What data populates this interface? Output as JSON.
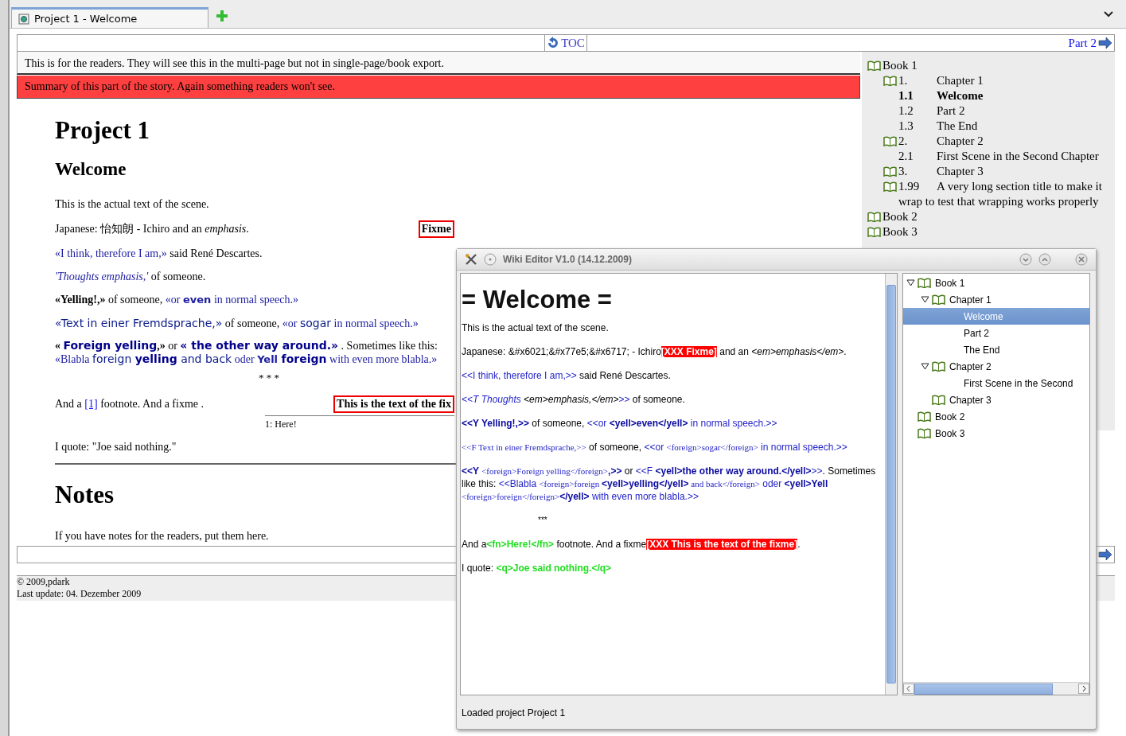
{
  "browser_tabs": [
    {
      "label": "Project 1 - Welcome",
      "selected": true
    }
  ],
  "nav_top": {
    "toc": "TOC",
    "next": "Part 2"
  },
  "reader_note": "This is for the readers. They will see this in the multi-page but not in single-page/book export.",
  "summary": "Summary of this part of the story. Again something readers won't see.",
  "article": {
    "title": "Project 1",
    "heading": "Welcome",
    "blocks": [
      {
        "kind": "para",
        "segments": [
          {
            "kind": "plain",
            "text": "This is the actual text of the scene."
          }
        ]
      },
      {
        "kind": "para",
        "segments": [
          {
            "kind": "plain",
            "text": "Japanese: 怡知朗 - Ichiro and an "
          },
          {
            "kind": "em",
            "text": "emphasis"
          },
          {
            "kind": "plain",
            "text": "."
          }
        ],
        "fixme": "Fixme"
      },
      {
        "kind": "para",
        "segments": [
          {
            "kind": "quote",
            "text": "«I think, therefore I am,»"
          },
          {
            "kind": "plain",
            "text": " said René Descartes."
          }
        ]
      },
      {
        "kind": "para",
        "segments": [
          {
            "kind": "thought",
            "text": "'Thoughts emphasis,'"
          },
          {
            "kind": "plain",
            "text": " of someone."
          }
        ]
      },
      {
        "kind": "para",
        "segments": [
          {
            "kind": "yell",
            "text": "«Yelling!,»"
          },
          {
            "kind": "plain",
            "text": " of someone, "
          },
          {
            "kind": "quote",
            "text": "«or "
          },
          {
            "kind": "quote-yell",
            "text": "even"
          },
          {
            "kind": "quote",
            "text": " in normal speech.»"
          }
        ]
      },
      {
        "kind": "para",
        "segments": [
          {
            "kind": "foreign",
            "text": "«Text in einer Fremdsprache,»"
          },
          {
            "kind": "plain",
            "text": " of someone, "
          },
          {
            "kind": "quote",
            "text": "«or "
          },
          {
            "kind": "foreign",
            "text": "sogar"
          },
          {
            "kind": "quote",
            "text": " in normal speech.»"
          }
        ]
      },
      {
        "kind": "para",
        "segments": [
          {
            "kind": "yell",
            "text": "« "
          },
          {
            "kind": "foreign-yell",
            "text": "Foreign yelling"
          },
          {
            "kind": "yell",
            "text": ",»"
          },
          {
            "kind": "plain",
            "text": " or "
          },
          {
            "kind": "foreign-yell",
            "text": "« the other way around.»"
          },
          {
            "kind": "plain",
            "text": " . Sometimes like this: "
          },
          {
            "kind": "quote",
            "text": "«Blabla "
          },
          {
            "kind": "foreign",
            "text": "foreign "
          },
          {
            "kind": "foreign-yell",
            "text": "yelling"
          },
          {
            "kind": "foreign",
            "text": " and back"
          },
          {
            "kind": "quote",
            "text": " oder "
          },
          {
            "kind": "quote-yell",
            "text": "Yell "
          },
          {
            "kind": "foreign-yell",
            "text": "foreign"
          },
          {
            "kind": "quote",
            "text": " with even more blabla.»"
          }
        ]
      },
      {
        "kind": "separator",
        "text": "* * *"
      },
      {
        "kind": "para",
        "segments": [
          {
            "kind": "plain",
            "text": "And a "
          },
          {
            "kind": "link",
            "text": "[1]"
          },
          {
            "kind": "plain",
            "text": " footnote. And a fixme ."
          }
        ],
        "fixme": "This is the text of the fix"
      },
      {
        "kind": "footnotes",
        "items": [
          "1: Here!"
        ]
      },
      {
        "kind": "para",
        "segments": [
          {
            "kind": "plain",
            "text": "I quote: \"Joe said nothing.\""
          }
        ]
      }
    ],
    "notes_heading": "Notes",
    "notes": "If you have notes for the readers, put them here."
  },
  "footer": [
    "© 2009,pdark",
    "Last update: 04. Dezember 2009"
  ],
  "toc": [
    {
      "title": "Book 1",
      "children": [
        {
          "number": "1.",
          "title": "Chapter 1",
          "children": [
            {
              "number": "1.1",
              "title": "Welcome",
              "selected": true
            },
            {
              "number": "1.2",
              "title": "Part 2",
              "selected": false
            },
            {
              "number": "1.3",
              "title": "The End",
              "selected": false
            }
          ]
        },
        {
          "number": "2.",
          "title": "Chapter 2",
          "children": [
            {
              "number": "2.1",
              "title": "First Scene in the Second Chapter",
              "selected": false
            }
          ]
        },
        {
          "number": "3.",
          "title": "Chapter 3"
        },
        {
          "number": "1.99",
          "title": "A very long section title to make it wrap to test that wrapping works properly"
        }
      ]
    },
    {
      "title": "Book 2"
    },
    {
      "title": "Book 3"
    }
  ],
  "editor": {
    "title": "Wiki Editor V1.0 (14.12.2009)",
    "heading": "= Welcome =",
    "lines": [
      {
        "kind": "para",
        "segments": [
          {
            "kind": "plain",
            "text": "This is the actual text of the scene."
          }
        ]
      },
      {
        "kind": "para",
        "segments": [
          {
            "kind": "plain",
            "text": "Japanese: &#x6021;&#x77e5;&#x6717; - Ichiro"
          },
          {
            "kind": "fixme",
            "text": "[XXX Fixme]"
          },
          {
            "kind": "plain",
            "text": " and an "
          },
          {
            "kind": "em",
            "text": "<em>emphasis</em>"
          },
          {
            "kind": "plain",
            "text": "."
          }
        ]
      },
      {
        "kind": "para",
        "segments": [
          {
            "kind": "quote",
            "text": "<<I think, therefore I am,>>"
          },
          {
            "kind": "plain",
            "text": " said René Descartes."
          }
        ]
      },
      {
        "kind": "para",
        "segments": [
          {
            "kind": "quote-em",
            "text": "<<T Thoughts"
          },
          {
            "kind": "em",
            "text": " <em>emphasis,</em>"
          },
          {
            "kind": "quote",
            "text": ">>"
          },
          {
            "kind": "plain",
            "text": " of someone."
          }
        ]
      },
      {
        "kind": "para",
        "segments": [
          {
            "kind": "yell",
            "text": "<<Y Yelling!,>>"
          },
          {
            "kind": "plain",
            "text": " of someone, "
          },
          {
            "kind": "quote",
            "text": "<<or "
          },
          {
            "kind": "yell",
            "text": "<yell>even</yell>"
          },
          {
            "kind": "quote",
            "text": " in normal speech.>>"
          }
        ]
      },
      {
        "kind": "para",
        "segments": [
          {
            "kind": "foreign",
            "text": "<<F Text in einer Fremdsprache,>>"
          },
          {
            "kind": "plain",
            "text": " of someone, "
          },
          {
            "kind": "quote",
            "text": "<<or "
          },
          {
            "kind": "foreign",
            "text": "<foreign>sogar</foreign>"
          },
          {
            "kind": "quote",
            "text": " in normal speech.>>"
          }
        ]
      },
      {
        "kind": "para",
        "segments": [
          {
            "kind": "yell",
            "text": "<<Y "
          },
          {
            "kind": "foreign",
            "text": "<foreign>Foreign yelling</foreign>"
          },
          {
            "kind": "yell",
            "text": ",>>"
          },
          {
            "kind": "plain",
            "text": " or "
          },
          {
            "kind": "quote",
            "text": "<<F "
          },
          {
            "kind": "yell",
            "text": "<yell>the other way around.</yell>"
          },
          {
            "kind": "quote",
            "text": ">>"
          },
          {
            "kind": "plain",
            "text": ". Sometimes like this: "
          },
          {
            "kind": "quote",
            "text": "<<Blabla "
          },
          {
            "kind": "foreign",
            "text": "<foreign>foreign "
          },
          {
            "kind": "yell",
            "text": "<yell>yelling</yell>"
          },
          {
            "kind": "foreign",
            "text": " and back</foreign>"
          },
          {
            "kind": "quote",
            "text": " oder "
          },
          {
            "kind": "yell",
            "text": "<yell>Yell "
          },
          {
            "kind": "foreign",
            "text": "<foreign>foreign</foreign>"
          },
          {
            "kind": "yell",
            "text": "</yell>"
          },
          {
            "kind": "quote",
            "text": " with even more blabla.>>"
          }
        ]
      },
      {
        "kind": "separator",
        "segments": [
          {
            "kind": "plain",
            "text": "***"
          }
        ]
      },
      {
        "kind": "para",
        "segments": [
          {
            "kind": "plain",
            "text": "And a"
          },
          {
            "kind": "green",
            "text": "<fn>Here!</fn>"
          },
          {
            "kind": "plain",
            "text": " footnote. And a fixme"
          },
          {
            "kind": "fixme",
            "text": "[XXX This is the text of the fixme]"
          },
          {
            "kind": "plain",
            "text": "."
          }
        ]
      },
      {
        "kind": "para",
        "segments": [
          {
            "kind": "plain",
            "text": "I quote: "
          },
          {
            "kind": "green",
            "text": "<q>Joe said nothing.</q>"
          }
        ]
      }
    ],
    "tree": [
      {
        "label": "Book 1",
        "expanded": true,
        "selected": false,
        "children": [
          {
            "label": "Chapter 1",
            "expanded": true,
            "selected": false,
            "children": [
              {
                "label": "Welcome",
                "selected": true
              },
              {
                "label": "Part 2",
                "selected": false
              },
              {
                "label": "The End",
                "selected": false
              }
            ]
          },
          {
            "label": "Chapter 2",
            "expanded": true,
            "selected": false,
            "children": [
              {
                "label": "First Scene in the Second",
                "selected": false
              }
            ]
          },
          {
            "label": "Chapter 3",
            "selected": false
          }
        ]
      },
      {
        "label": "Book 2",
        "selected": false
      },
      {
        "label": "Book 3",
        "selected": false
      }
    ],
    "status": "Loaded project Project 1"
  }
}
